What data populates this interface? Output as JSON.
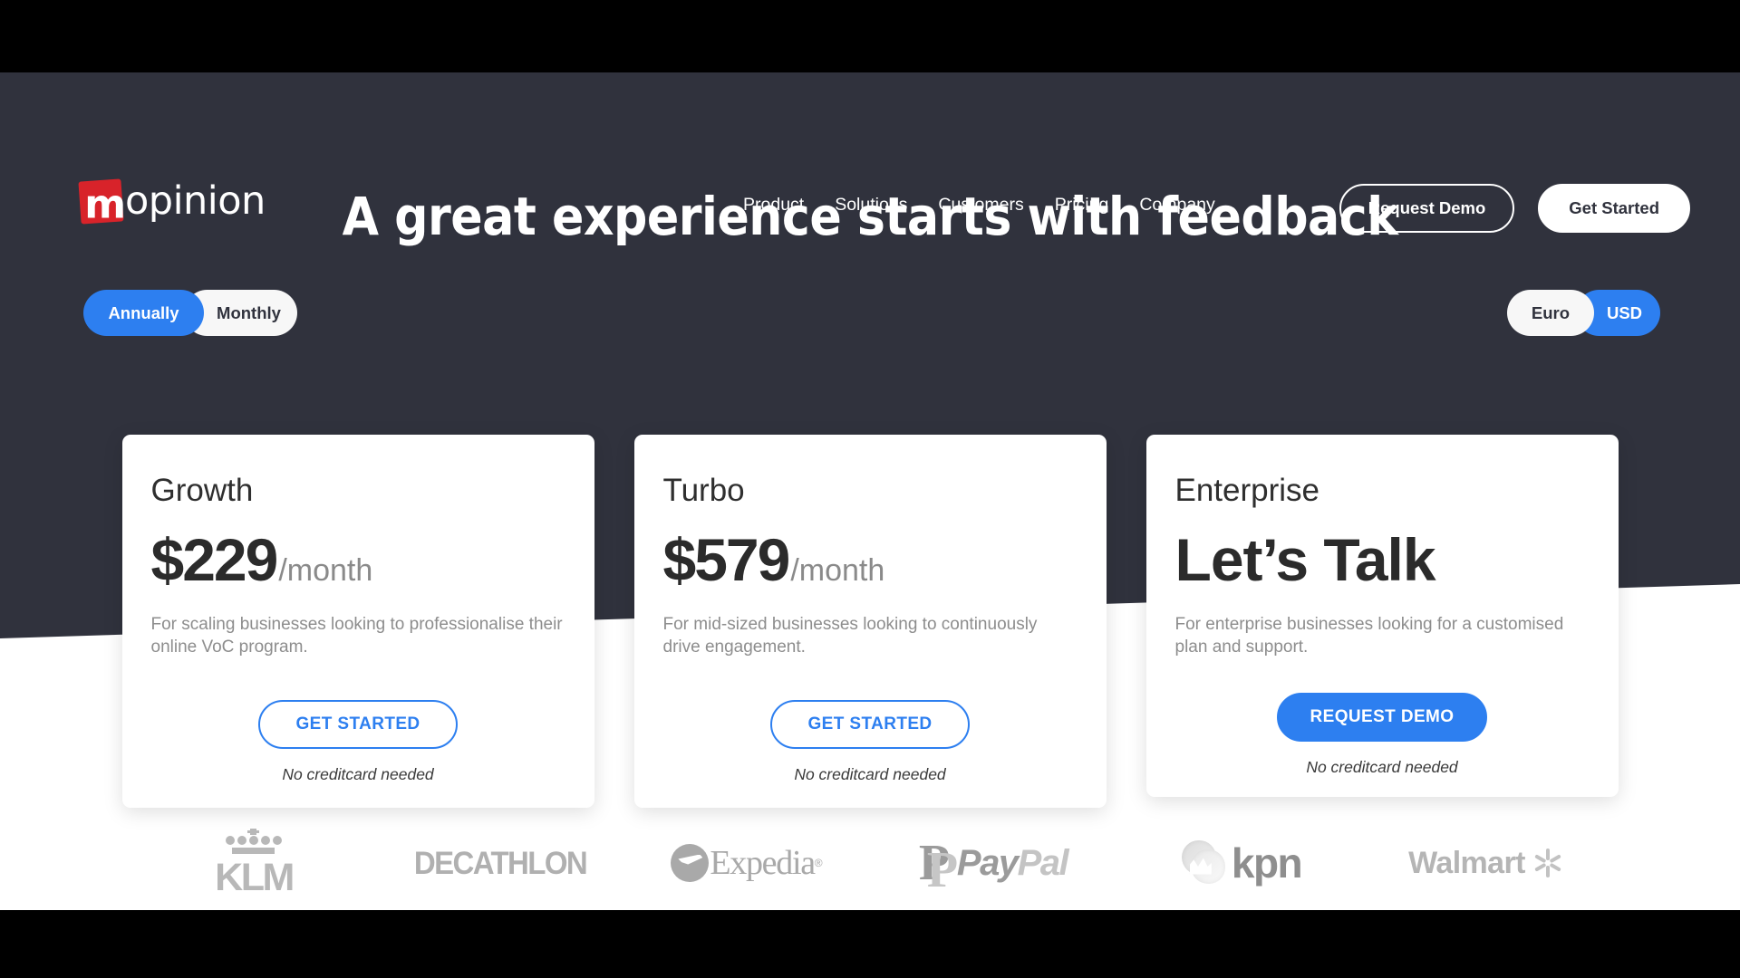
{
  "brand": {
    "logo_mark": "m",
    "logo_text": "opinion",
    "logo_color": "#d8232a"
  },
  "nav": {
    "links": [
      {
        "label": "Product"
      },
      {
        "label": "Solutions"
      },
      {
        "label": "Customers"
      },
      {
        "label": "Pricing"
      },
      {
        "label": "Company"
      }
    ],
    "request_demo": "Request Demo",
    "get_started": "Get Started"
  },
  "hero": {
    "headline": "A great experience starts with feedback",
    "background_color": "#30323d"
  },
  "billing_toggle": {
    "options": [
      {
        "label": "Annually",
        "active": true
      },
      {
        "label": "Monthly",
        "active": false
      }
    ]
  },
  "currency_toggle": {
    "options": [
      {
        "label": "Euro",
        "active": false
      },
      {
        "label": "USD",
        "active": true
      }
    ]
  },
  "accent_color": "#2d7ff0",
  "plans": [
    {
      "title": "Growth",
      "price": "$229",
      "period": "/month",
      "description": "For scaling businesses looking to professionalise their online VoC program.",
      "cta": "GET STARTED",
      "cta_style": "outline",
      "note": "No creditcard needed"
    },
    {
      "title": "Turbo",
      "price": "$579",
      "period": "/month",
      "description": "For mid-sized businesses looking to continuously drive engagement.",
      "cta": "GET STARTED",
      "cta_style": "outline",
      "note": "No creditcard needed"
    },
    {
      "title": "Enterprise",
      "price": "Let’s Talk",
      "period": "",
      "description": "For enterprise businesses looking for a customised plan and support.",
      "cta": "REQUEST DEMO",
      "cta_style": "solid",
      "note": "No creditcard needed"
    }
  ],
  "client_logos": [
    {
      "name": "KLM",
      "text": "KLM"
    },
    {
      "name": "Decathlon",
      "text": "DECATHLON"
    },
    {
      "name": "Expedia",
      "text": "Expedia"
    },
    {
      "name": "PayPal",
      "text_a": "Pay",
      "text_b": "Pal"
    },
    {
      "name": "KPN",
      "text": "kpn"
    },
    {
      "name": "Walmart",
      "text": "Walmart"
    }
  ]
}
